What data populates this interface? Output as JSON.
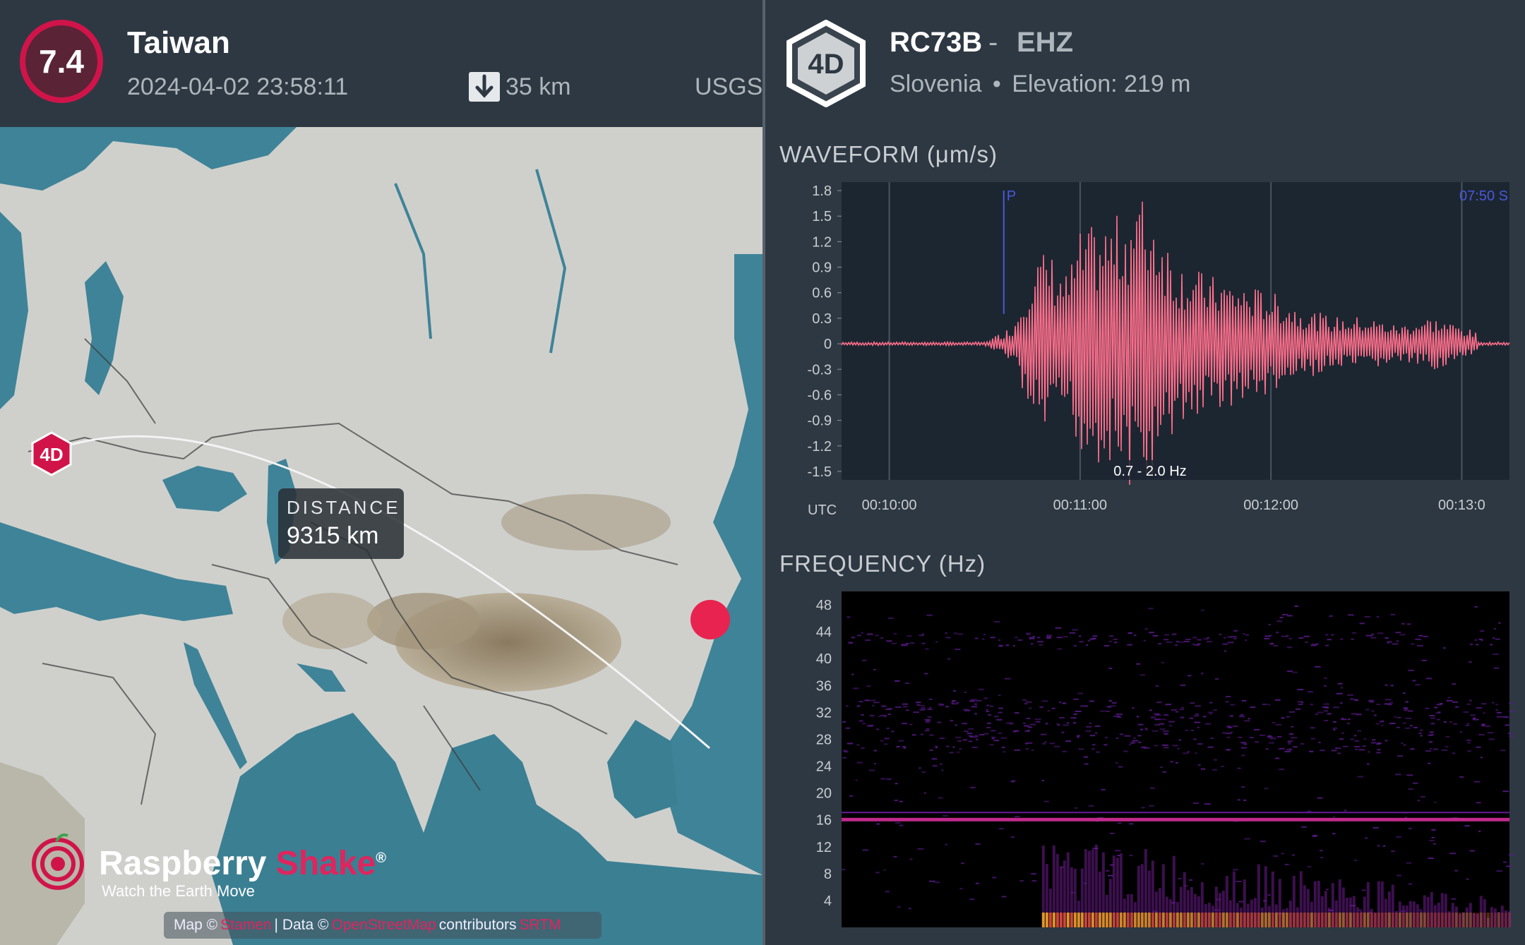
{
  "event": {
    "magnitude": "7.4",
    "region": "Taiwan",
    "datetime": "2024-04-02 23:58:11",
    "depth": "35 km",
    "source": "USGS"
  },
  "map": {
    "station_marker": "4D",
    "distance_label": "DISTANCE",
    "distance_value": "9315 km",
    "brand_part1": "Raspberry",
    "brand_part2": "Shake",
    "brand_reg": "®",
    "tagline": "Watch the Earth Move",
    "attribution_map": "Map ©",
    "attribution_link1": "Stamen",
    "attribution_data": "| Data ©",
    "attribution_link2": "OpenStreetMap",
    "attribution_contrib": "contributors",
    "attribution_link3": "SRTM",
    "colors": {
      "land": "#cfd2cf",
      "ocean": "#3b8094",
      "epicenter": "#e8234f",
      "station": "#d0144a"
    },
    "icons": [
      "depth-arrow-icon",
      "station-hex-icon",
      "raspberry-shake-logo-icon"
    ]
  },
  "station": {
    "network": "4D",
    "code": "RC73B",
    "separator": "-",
    "channel": "EHZ",
    "country": "Slovenia",
    "bullet": "•",
    "elevation": "Elevation: 219 m"
  },
  "waveform": {
    "title": "WAVEFORM (μm/s)",
    "utc_label": "UTC",
    "p_label": "P",
    "s_label": "07:50  S",
    "filter_label": "0.7 - 2.0 Hz",
    "y_ticks": [
      "1.8",
      "1.5",
      "1.2",
      "0.9",
      "0.6",
      "0.3",
      "0",
      "-0.3",
      "-0.6",
      "-0.9",
      "-1.2",
      "-1.5"
    ],
    "x_ticks": [
      "00:10:00",
      "00:11:00",
      "00:12:00",
      "00:13:0"
    ],
    "colors": {
      "trace": "#ff6f8c",
      "phase": "#4a58d8",
      "grid": "#4a5560"
    }
  },
  "frequency": {
    "title": "FREQUENCY (Hz)",
    "y_ticks": [
      "48",
      "44",
      "40",
      "36",
      "32",
      "28",
      "24",
      "20",
      "16",
      "12",
      "8",
      "4"
    ]
  },
  "chart_data": [
    {
      "type": "line",
      "title": "WAVEFORM (μm/s)",
      "xlabel": "UTC",
      "ylabel": "μm/s",
      "ylim": [
        -1.6,
        1.9
      ],
      "x_ticks": [
        "00:10:00",
        "00:11:00",
        "00:12:00",
        "00:13:0"
      ],
      "series": [
        {
          "x": [
            "00:09:45",
            "00:10:00",
            "00:10:30",
            "00:10:39",
            "00:10:45",
            "00:10:50",
            "00:10:56",
            "00:11:00",
            "00:11:06",
            "00:11:12",
            "00:11:18",
            "00:11:24",
            "00:11:30",
            "00:11:40",
            "00:11:50",
            "00:12:00",
            "00:12:10",
            "00:12:20",
            "00:12:30",
            "00:12:40",
            "00:12:50",
            "00:13:00",
            "00:13:05"
          ],
          "values": [
            0.0,
            0.0,
            0.0,
            0.2,
            1.0,
            -1.1,
            0.8,
            -1.3,
            1.4,
            -1.5,
            1.8,
            -1.6,
            1.0,
            -0.8,
            0.7,
            -0.6,
            0.4,
            -0.3,
            0.3,
            -0.2,
            0.3,
            -0.2,
            0.1
          ]
        }
      ],
      "annotations": [
        "P",
        "07:50 S",
        "0.7 - 2.0 Hz"
      ]
    },
    {
      "type": "heatmap",
      "title": "FREQUENCY (Hz)",
      "ylim": [
        0,
        50
      ],
      "y_ticks": [
        48,
        44,
        40,
        36,
        32,
        28,
        24,
        20,
        16,
        12,
        8,
        4
      ]
    }
  ]
}
